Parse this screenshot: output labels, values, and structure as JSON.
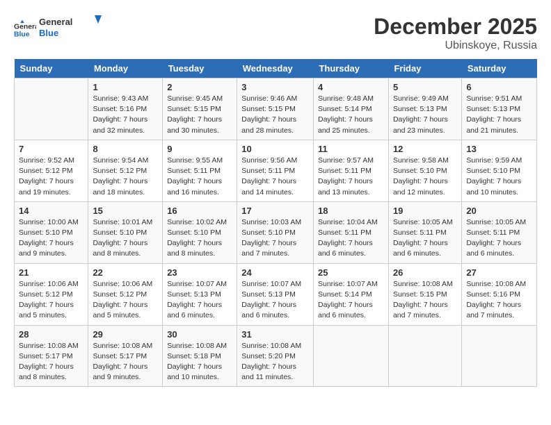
{
  "logo": {
    "line1": "General",
    "line2": "Blue"
  },
  "title": "December 2025",
  "subtitle": "Ubinskoye, Russia",
  "weekdays": [
    "Sunday",
    "Monday",
    "Tuesday",
    "Wednesday",
    "Thursday",
    "Friday",
    "Saturday"
  ],
  "weeks": [
    [
      {
        "day": "",
        "info": ""
      },
      {
        "day": "1",
        "info": "Sunrise: 9:43 AM\nSunset: 5:16 PM\nDaylight: 7 hours\nand 32 minutes."
      },
      {
        "day": "2",
        "info": "Sunrise: 9:45 AM\nSunset: 5:15 PM\nDaylight: 7 hours\nand 30 minutes."
      },
      {
        "day": "3",
        "info": "Sunrise: 9:46 AM\nSunset: 5:15 PM\nDaylight: 7 hours\nand 28 minutes."
      },
      {
        "day": "4",
        "info": "Sunrise: 9:48 AM\nSunset: 5:14 PM\nDaylight: 7 hours\nand 25 minutes."
      },
      {
        "day": "5",
        "info": "Sunrise: 9:49 AM\nSunset: 5:13 PM\nDaylight: 7 hours\nand 23 minutes."
      },
      {
        "day": "6",
        "info": "Sunrise: 9:51 AM\nSunset: 5:13 PM\nDaylight: 7 hours\nand 21 minutes."
      }
    ],
    [
      {
        "day": "7",
        "info": "Sunrise: 9:52 AM\nSunset: 5:12 PM\nDaylight: 7 hours\nand 19 minutes."
      },
      {
        "day": "8",
        "info": "Sunrise: 9:54 AM\nSunset: 5:12 PM\nDaylight: 7 hours\nand 18 minutes."
      },
      {
        "day": "9",
        "info": "Sunrise: 9:55 AM\nSunset: 5:11 PM\nDaylight: 7 hours\nand 16 minutes."
      },
      {
        "day": "10",
        "info": "Sunrise: 9:56 AM\nSunset: 5:11 PM\nDaylight: 7 hours\nand 14 minutes."
      },
      {
        "day": "11",
        "info": "Sunrise: 9:57 AM\nSunset: 5:11 PM\nDaylight: 7 hours\nand 13 minutes."
      },
      {
        "day": "12",
        "info": "Sunrise: 9:58 AM\nSunset: 5:10 PM\nDaylight: 7 hours\nand 12 minutes."
      },
      {
        "day": "13",
        "info": "Sunrise: 9:59 AM\nSunset: 5:10 PM\nDaylight: 7 hours\nand 10 minutes."
      }
    ],
    [
      {
        "day": "14",
        "info": "Sunrise: 10:00 AM\nSunset: 5:10 PM\nDaylight: 7 hours\nand 9 minutes."
      },
      {
        "day": "15",
        "info": "Sunrise: 10:01 AM\nSunset: 5:10 PM\nDaylight: 7 hours\nand 8 minutes."
      },
      {
        "day": "16",
        "info": "Sunrise: 10:02 AM\nSunset: 5:10 PM\nDaylight: 7 hours\nand 8 minutes."
      },
      {
        "day": "17",
        "info": "Sunrise: 10:03 AM\nSunset: 5:10 PM\nDaylight: 7 hours\nand 7 minutes."
      },
      {
        "day": "18",
        "info": "Sunrise: 10:04 AM\nSunset: 5:11 PM\nDaylight: 7 hours\nand 6 minutes."
      },
      {
        "day": "19",
        "info": "Sunrise: 10:05 AM\nSunset: 5:11 PM\nDaylight: 7 hours\nand 6 minutes."
      },
      {
        "day": "20",
        "info": "Sunrise: 10:05 AM\nSunset: 5:11 PM\nDaylight: 7 hours\nand 6 minutes."
      }
    ],
    [
      {
        "day": "21",
        "info": "Sunrise: 10:06 AM\nSunset: 5:12 PM\nDaylight: 7 hours\nand 5 minutes."
      },
      {
        "day": "22",
        "info": "Sunrise: 10:06 AM\nSunset: 5:12 PM\nDaylight: 7 hours\nand 5 minutes."
      },
      {
        "day": "23",
        "info": "Sunrise: 10:07 AM\nSunset: 5:13 PM\nDaylight: 7 hours\nand 6 minutes."
      },
      {
        "day": "24",
        "info": "Sunrise: 10:07 AM\nSunset: 5:13 PM\nDaylight: 7 hours\nand 6 minutes."
      },
      {
        "day": "25",
        "info": "Sunrise: 10:07 AM\nSunset: 5:14 PM\nDaylight: 7 hours\nand 6 minutes."
      },
      {
        "day": "26",
        "info": "Sunrise: 10:08 AM\nSunset: 5:15 PM\nDaylight: 7 hours\nand 7 minutes."
      },
      {
        "day": "27",
        "info": "Sunrise: 10:08 AM\nSunset: 5:16 PM\nDaylight: 7 hours\nand 7 minutes."
      }
    ],
    [
      {
        "day": "28",
        "info": "Sunrise: 10:08 AM\nSunset: 5:17 PM\nDaylight: 7 hours\nand 8 minutes."
      },
      {
        "day": "29",
        "info": "Sunrise: 10:08 AM\nSunset: 5:17 PM\nDaylight: 7 hours\nand 9 minutes."
      },
      {
        "day": "30",
        "info": "Sunrise: 10:08 AM\nSunset: 5:18 PM\nDaylight: 7 hours\nand 10 minutes."
      },
      {
        "day": "31",
        "info": "Sunrise: 10:08 AM\nSunset: 5:20 PM\nDaylight: 7 hours\nand 11 minutes."
      },
      {
        "day": "",
        "info": ""
      },
      {
        "day": "",
        "info": ""
      },
      {
        "day": "",
        "info": ""
      }
    ]
  ]
}
